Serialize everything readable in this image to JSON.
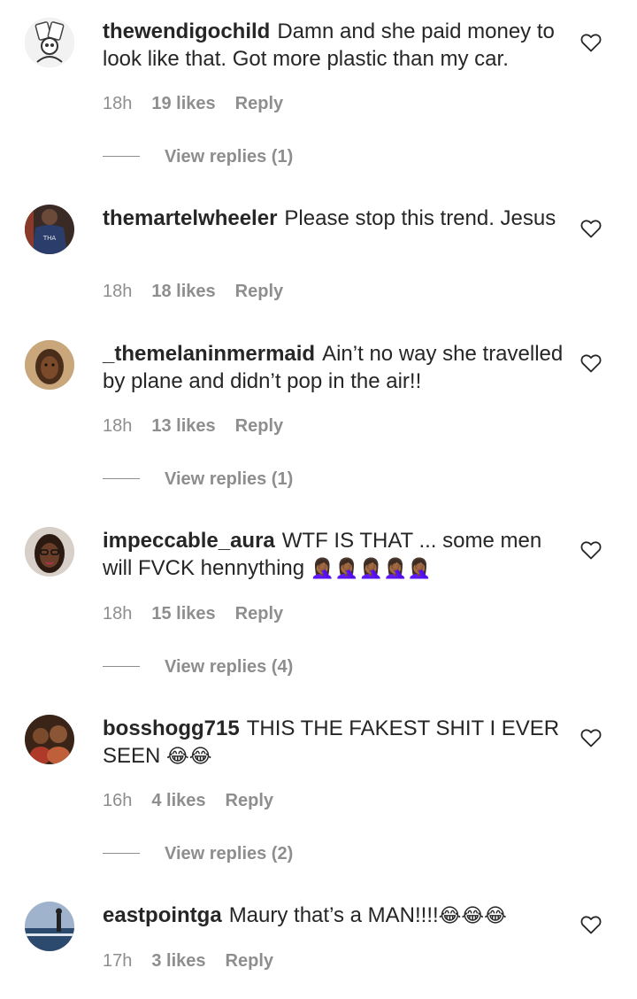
{
  "comments": [
    {
      "username": "thewendigochild",
      "text": "Damn and she paid money to look like that. Got more plastic than my car.",
      "time": "18h",
      "likes": "19 likes",
      "reply": "Reply",
      "view_replies": "View replies (1)",
      "avatar_icon": "skeleton-cards-avatar"
    },
    {
      "username": "themartelwheeler",
      "text": "Please stop this trend. Jesus",
      "time": "18h",
      "likes": "18 likes",
      "reply": "Reply",
      "avatar_icon": "jersey-avatar"
    },
    {
      "username": "_themelaninmermaid",
      "text": "Ain’t no way she travelled by plane and didn’t pop in the air!!",
      "time": "18h",
      "likes": "13 likes",
      "reply": "Reply",
      "view_replies": "View replies (1)",
      "avatar_icon": "portrait-avatar"
    },
    {
      "username": "impeccable_aura",
      "text": "WTF IS THAT ... some men will FVCK hennything",
      "emoji": "🤦🏾‍♀️🤦🏾‍♀️🤦🏾‍♀️🤦🏾‍♀️🤦🏾‍♀️",
      "time": "18h",
      "likes": "15 likes",
      "reply": "Reply",
      "view_replies": "View replies (4)",
      "avatar_icon": "glasses-portrait-avatar"
    },
    {
      "username": "bosshogg715",
      "text": "THIS THE FAKEST SHIT I EVER SEEN",
      "emoji": "😂😂",
      "time": "16h",
      "likes": "4 likes",
      "reply": "Reply",
      "view_replies": "View replies (2)",
      "avatar_icon": "group-photo-avatar"
    },
    {
      "username": "eastpointga",
      "text": "Maury that’s a MAN!!!!",
      "emoji": "😂😂😂",
      "time": "17h",
      "likes": "3 likes",
      "reply": "Reply",
      "avatar_icon": "seaside-avatar"
    }
  ],
  "colors": {
    "text": "#262626",
    "secondary": "#8e8e8e",
    "background": "#ffffff"
  },
  "icons": {
    "like": "heart-outline-icon"
  }
}
